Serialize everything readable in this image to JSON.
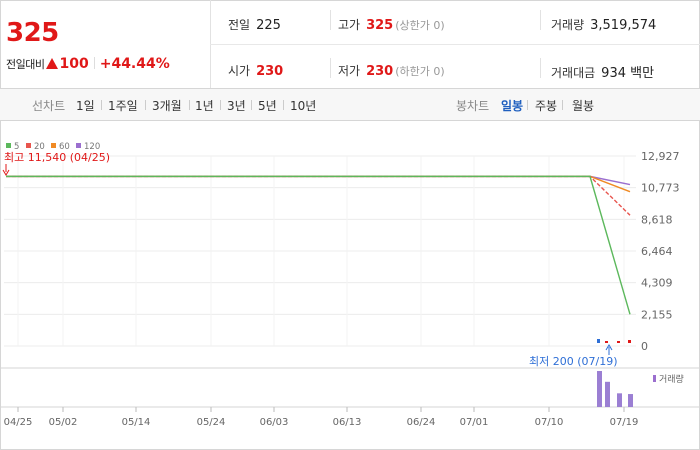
{
  "summary": {
    "price": "325",
    "change_label": "전일대비",
    "change_value": "100",
    "change_rate": "+44.44%"
  },
  "stats": {
    "prev_label": "전일",
    "prev_value": "225",
    "high_label": "고가",
    "high_value": "325",
    "high_note": "(상한가 0)",
    "volume_label": "거래량",
    "volume_value": "3,519,574",
    "open_label": "시가",
    "open_value": "230",
    "low_label": "저가",
    "low_value": "230",
    "low_note": "(하한가 0)",
    "amount_label": "거래대금",
    "amount_value": "934",
    "amount_unit": "백만"
  },
  "tabs": {
    "line_label": "선차트",
    "line_periods": [
      "1일",
      "1주일",
      "3개월",
      "1년",
      "3년",
      "5년",
      "10년"
    ],
    "candle_label": "봉차트",
    "candle_periods": [
      "일봉",
      "주봉",
      "월봉"
    ],
    "active_candle": "일봉"
  },
  "chart_data": {
    "type": "line",
    "legend": [
      {
        "name": "5",
        "color": "#5cb85c"
      },
      {
        "name": "20",
        "color": "#e8554e"
      },
      {
        "name": "60",
        "color": "#f08a24"
      },
      {
        "name": "120",
        "color": "#9b6fcf"
      }
    ],
    "y_ticks": [
      "12,927",
      "10,773",
      "8,618",
      "6,464",
      "4,309",
      "2,155",
      "0"
    ],
    "ylim": [
      0,
      12927
    ],
    "x_ticks": [
      "04/25",
      "05/02",
      "05/14",
      "05/24",
      "06/03",
      "06/13",
      "06/24",
      "07/01",
      "07/10",
      "07/19"
    ],
    "high_annotation": "최고 11,540 (04/25)",
    "low_annotation": "최저 200 (07/19)",
    "high_value": 11540,
    "low_value": 200,
    "series": [
      {
        "name": "5",
        "values_note": "flat",
        "start": 11540,
        "end": 2155
      },
      {
        "name": "20",
        "start": 11540,
        "end": 8900
      },
      {
        "name": "60",
        "start": 11540,
        "end": 10500
      },
      {
        "name": "120",
        "start": 11540,
        "end": 10980
      }
    ],
    "volume_label": "거래량",
    "volume_bars": [
      1.0,
      0.7,
      0.38,
      0.36
    ]
  }
}
